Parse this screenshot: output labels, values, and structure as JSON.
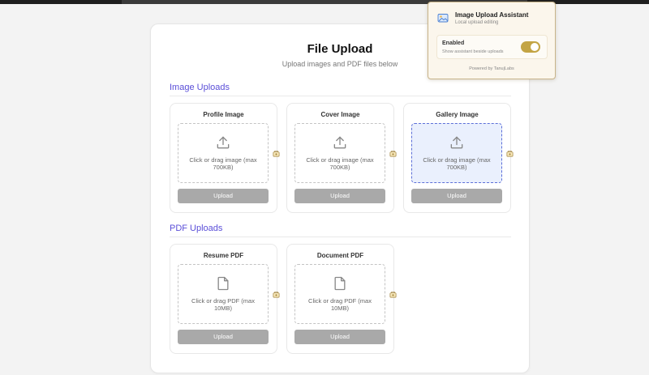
{
  "page": {
    "title": "File Upload",
    "subtitle": "Upload images and PDF files below"
  },
  "sections": {
    "image": {
      "title": "Image Uploads",
      "tiles": [
        {
          "title": "Profile Image",
          "hint": "Click or drag image (max 700KB)",
          "button": "Upload",
          "icon": "upload-icon",
          "active": false
        },
        {
          "title": "Cover Image",
          "hint": "Click or drag image (max 700KB)",
          "button": "Upload",
          "icon": "upload-icon",
          "active": false
        },
        {
          "title": "Gallery Image",
          "hint": "Click or drag image (max 700KB)",
          "button": "Upload",
          "icon": "upload-icon",
          "active": true
        }
      ]
    },
    "pdf": {
      "title": "PDF Uploads",
      "tiles": [
        {
          "title": "Resume PDF",
          "hint": "Click or drag PDF (max 10MB)",
          "button": "Upload",
          "icon": "document-icon",
          "active": false
        },
        {
          "title": "Document PDF",
          "hint": "Click or drag PDF (max 10MB)",
          "button": "Upload",
          "icon": "document-icon",
          "active": false
        }
      ]
    }
  },
  "assistant": {
    "title": "Image Upload Assistant",
    "subtitle": "Local upload editing",
    "toggle_label": "Enabled",
    "toggle_desc": "Show assistant beside uploads",
    "toggle_on": true,
    "footer": "Powered by TanujLabs"
  },
  "colors": {
    "accent": "#5a4ed8",
    "toggle": "#c3a444",
    "button": "#a9a9a9",
    "active_dropzone": "#eaf0fd"
  }
}
